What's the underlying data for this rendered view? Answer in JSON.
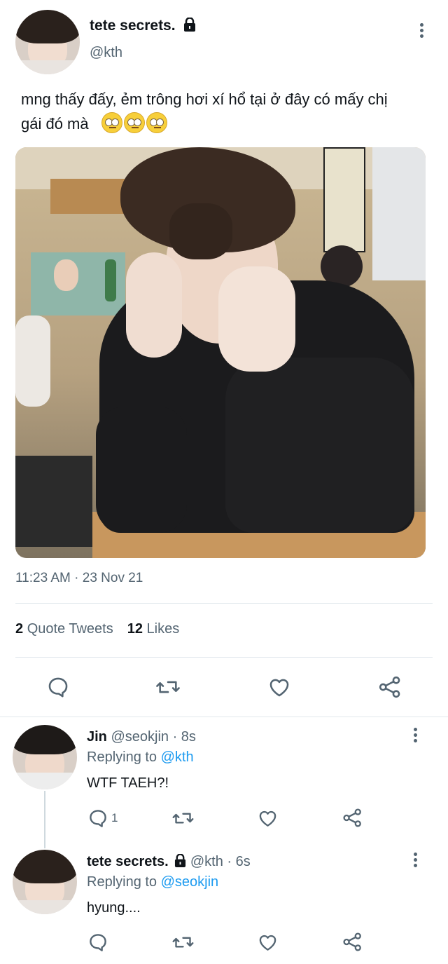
{
  "tweet": {
    "author_name": "tete secrets.",
    "author_handle": "@kth",
    "text_line1": "mng thấy đấy, ẻm trông hơi xí hổ tại ở đây có mấy chị",
    "text_line2": "gái đó mà",
    "timestamp": "11:23 AM · 23 Nov 21",
    "quote_tweets_count": "2",
    "quote_tweets_label": "Quote Tweets",
    "likes_count": "12",
    "likes_label": "Likes"
  },
  "replies": [
    {
      "name": "Jin",
      "meta": "@seokjin · 8s",
      "replying_prefix": "Replying to",
      "replying_to": "@kth",
      "text": "WTF TAEH?!",
      "reply_count": "1"
    },
    {
      "name": "tete secrets.",
      "meta": "@kth · 6s",
      "replying_prefix": "Replying to",
      "replying_to": "@seokjin",
      "text": "hyung....",
      "reply_count": ""
    }
  ],
  "icons": [
    "lock-icon",
    "more-icon",
    "reply-icon",
    "retweet-icon",
    "like-icon",
    "share-icon",
    "rolling-eyes-emoji"
  ],
  "colors": {
    "text": "#0f1419",
    "secondary": "#536471",
    "link": "#1d9bf0",
    "divider": "#e1e8ed"
  }
}
